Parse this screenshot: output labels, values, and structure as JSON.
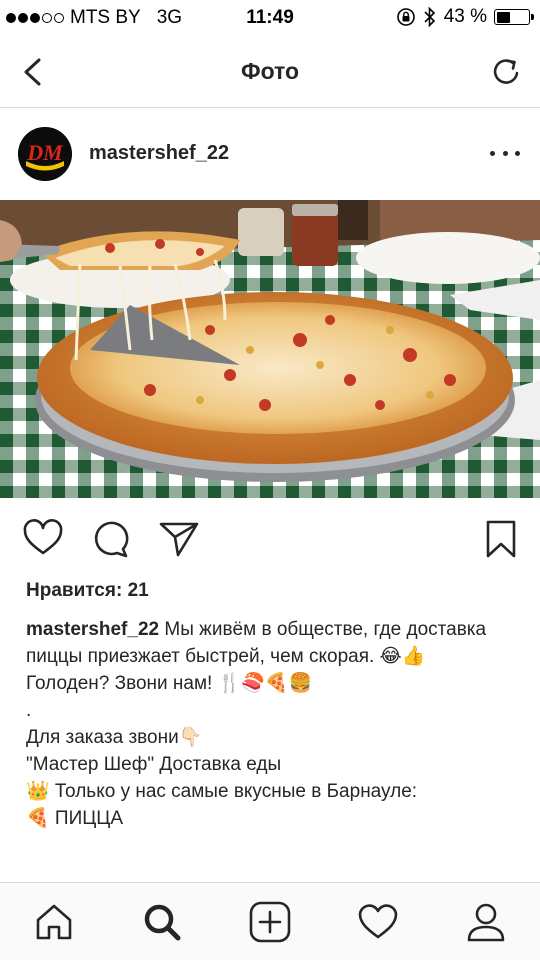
{
  "status_bar": {
    "carrier": "MTS BY",
    "network": "3G",
    "time": "11:49",
    "battery": "43 %",
    "battery_level": 0.43,
    "signal_bars": 3,
    "icons": [
      "orientation-lock-icon",
      "bluetooth-icon",
      "battery-icon"
    ]
  },
  "nav": {
    "title": "Фото",
    "back_icon": "chevron-left-icon",
    "refresh_icon": "refresh-icon"
  },
  "post": {
    "username": "mastershef_22",
    "avatar_logo_text": "DM",
    "more_icon": "more-dots-icon",
    "photo": "pizza-photo",
    "likes": "Нравится: 21",
    "caption": {
      "username": "mastershef_22",
      "text": "Мы живём в обществе, где доставка пиццы приезжает быстрей, чем скорая. 😂👍",
      "line2": "Голоден? Звони нам! 🍴🍣🍕🍔",
      "line3": ".",
      "line4": "Для заказа звони👇🏻",
      "line5": "\"Мастер Шеф\" Доставка еды",
      "line6": "👑 Только у нас самые вкусные в Барнауле:",
      "line7": "🍕 ПИЦЦА"
    }
  },
  "actions": [
    "heart-icon",
    "comment-icon",
    "share-icon",
    "bookmark-icon"
  ],
  "tabbar": [
    "home-icon",
    "search-icon",
    "add-post-icon",
    "activity-heart-icon",
    "profile-icon"
  ],
  "colors": {
    "text": "#262626",
    "divider": "#dbdbdb",
    "logo_red": "#d9261c",
    "logo_yellow": "#f2c300"
  }
}
